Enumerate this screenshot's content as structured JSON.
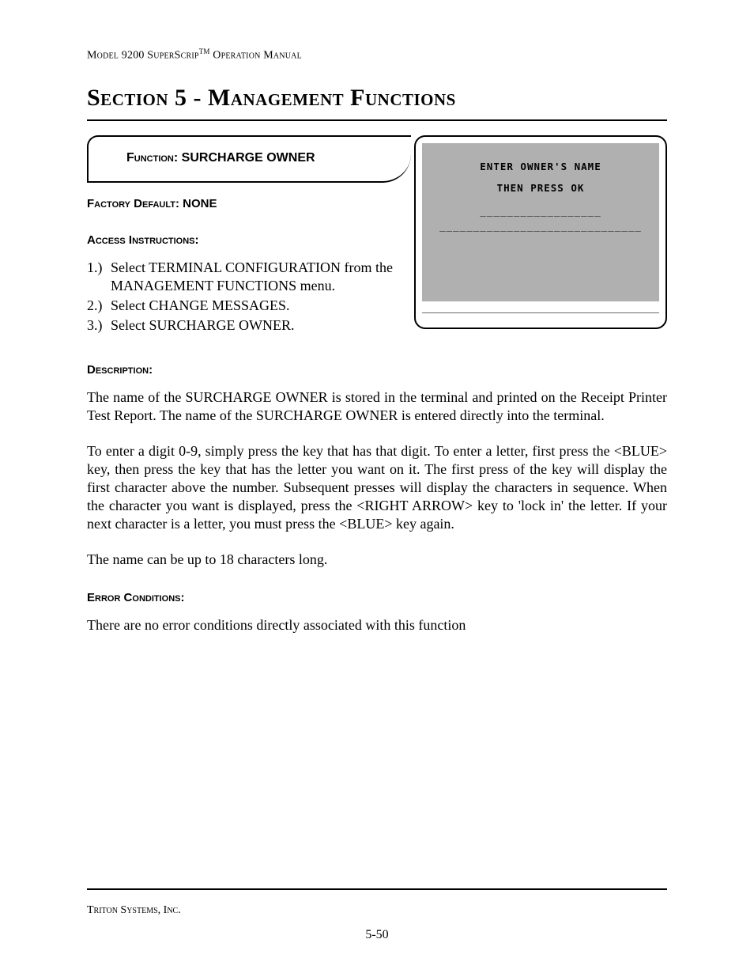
{
  "header": {
    "model": "Model 9200 SuperScrip",
    "tm": "TM",
    "suffix": " Operation Manual"
  },
  "section_title": "Section 5 - Management Functions",
  "function_box": {
    "label_prefix": "Function:  ",
    "label_value": "SURCHARGE OWNER"
  },
  "screen": {
    "line1": "ENTER OWNER'S NAME",
    "line2": "THEN PRESS OK",
    "dashes1": "__________________",
    "dashes2": "______________________________"
  },
  "factory_default": {
    "label": "Factory Default: ",
    "value": "NONE"
  },
  "access_label": "Access Instructions:",
  "steps": [
    {
      "n": "1.)",
      "t": "Select TERMINAL CONFIGURATION from the MANAGEMENT FUNCTIONS menu."
    },
    {
      "n": "2.)",
      "t": "Select CHANGE MESSAGES."
    },
    {
      "n": "3.)",
      "t": "Select SURCHARGE OWNER."
    }
  ],
  "description_label": "Description:",
  "paragraphs": {
    "p1": "The name of the SURCHARGE OWNER is stored in the terminal and printed on the Receipt Printer Test Report. The name of the SURCHARGE OWNER is entered directly into the terminal.",
    "p2": "To enter a digit 0-9, simply press the key that has that digit.  To enter a letter, first press the <BLUE> key, then press the key that has the letter you want on it.  The first press of the key will display the first character above the number.  Subsequent presses will display the characters in sequence.  When the character you want is displayed, press the <RIGHT ARROW> key to 'lock in' the letter.  If your next character is a letter, you must press the <BLUE> key again.",
    "p3": "The name can be up to 18 characters long."
  },
  "error_label": "Error Conditions:",
  "error_text": "There are no error conditions directly associated with this function",
  "footer": {
    "company": "Triton Systems, Inc.",
    "page": "5-50"
  }
}
